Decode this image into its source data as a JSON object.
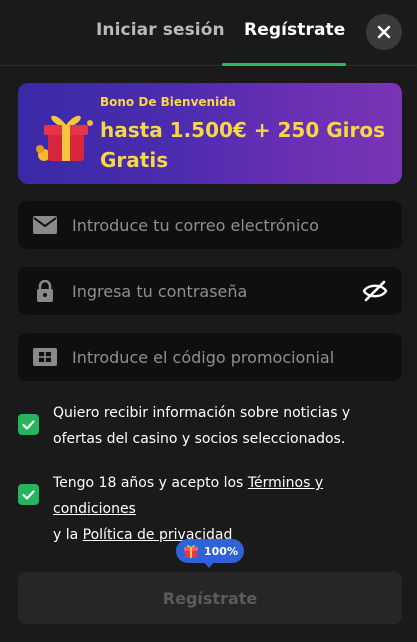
{
  "tabs": {
    "login_label": "Iniciar sesión",
    "register_label": "Regístrate",
    "active": "register"
  },
  "close_icon": "close-icon",
  "banner": {
    "eyebrow": "Bono De Bienvenida",
    "title": "hasta 1.500€ + 250 Giros Gratis",
    "accent_color": "#f7d64a"
  },
  "form": {
    "email_placeholder": "Introduce tu correo electrónico",
    "email_value": "",
    "password_placeholder": "Ingresa tu contraseña",
    "password_value": "",
    "promo_placeholder": "Introduce el código promocionial",
    "promo_value": ""
  },
  "consents": {
    "marketing_text": "Quiero recibir información sobre noticias y ofertas del casino y socios seleccionados.",
    "marketing_checked": true,
    "age_prefix": "Tengo 18 años y acepto los ",
    "terms_link": "Términos y condiciones",
    "age_mid": " y la ",
    "privacy_link": "Política de privacidad",
    "age_checked": true
  },
  "progress": {
    "label": "100%",
    "value": 100
  },
  "submit_label": "Regístrate",
  "colors": {
    "background": "#1a1a1a",
    "field_bg": "#0f0f0f",
    "accent_green": "#27b45d",
    "badge_blue": "#2f62d8"
  }
}
